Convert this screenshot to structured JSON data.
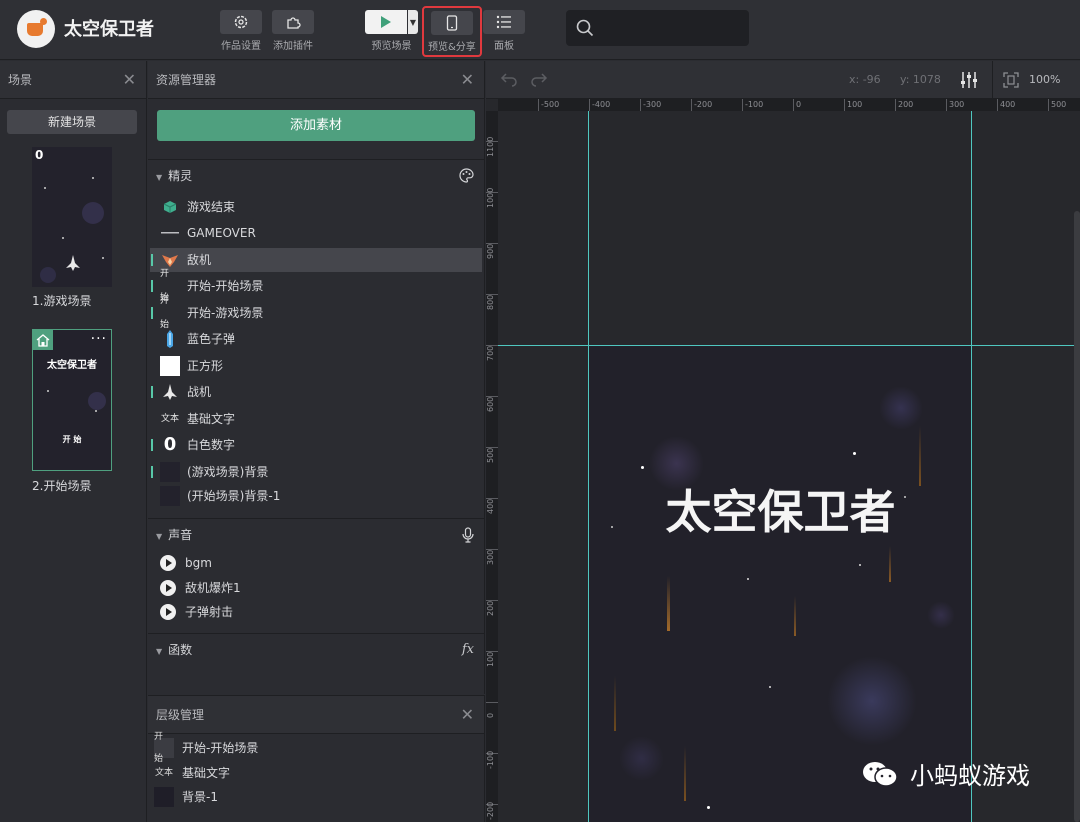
{
  "app": {
    "title": "太空保卫者"
  },
  "toolbar": {
    "settings_label": "作品设置",
    "plugin_label": "添加插件",
    "preview_scene_label": "预览场景",
    "preview_share_label": "预览&分享",
    "panel_label": "面板",
    "search_placeholder": ""
  },
  "scene_panel": {
    "title": "场景",
    "new_scene_label": "新建场景",
    "scenes": [
      {
        "label": "1.游戏场景",
        "score": "0"
      },
      {
        "label": "2.开始场景",
        "title": "太空保卫者",
        "button": "开 始"
      }
    ]
  },
  "asset_panel": {
    "title": "资源管理器",
    "add_asset_label": "添加素材",
    "sprites_header": "精灵",
    "sprites": [
      {
        "label": "游戏结束",
        "icon": "cube-icon"
      },
      {
        "label": "GAMEOVER",
        "icon": "text-line-icon"
      },
      {
        "label": "敌机",
        "icon": "enemy-plane-icon"
      },
      {
        "label": "开始-开始场景",
        "icon": "start-button-icon",
        "icon_text": "开 始"
      },
      {
        "label": "开始-游戏场景",
        "icon": "start-button-icon",
        "icon_text": "开 始"
      },
      {
        "label": "蓝色子弹",
        "icon": "bullet-icon"
      },
      {
        "label": "正方形",
        "icon": "square-icon"
      },
      {
        "label": "战机",
        "icon": "fighter-icon"
      },
      {
        "label": "基础文字",
        "icon": "text-icon",
        "icon_text": "文本"
      },
      {
        "label": "白色数字",
        "icon": "digit-icon",
        "icon_text": "0"
      },
      {
        "label": "(游戏场景)背景",
        "icon": "background-icon"
      },
      {
        "label": "(开始场景)背景-1",
        "icon": "background-icon"
      }
    ],
    "sounds_header": "声音",
    "sounds": [
      {
        "label": "bgm"
      },
      {
        "label": "敌机爆炸1"
      },
      {
        "label": "子弹射击"
      }
    ],
    "functions_header": "函数",
    "functions_icon_text": "fx"
  },
  "layer_panel": {
    "title": "层级管理",
    "layers": [
      {
        "label": "开始-开始场景",
        "icon_text": "开 始"
      },
      {
        "label": "基础文字",
        "icon_text": "文本"
      },
      {
        "label": "背景-1",
        "icon_text": ""
      }
    ]
  },
  "canvas": {
    "coord_x": "x: -96",
    "coord_y": "y: 1078",
    "zoom": "100%",
    "ruler_top": [
      "-500",
      "-400",
      "-300",
      "-200",
      "-100",
      "0",
      "100",
      "200",
      "300",
      "400",
      "500"
    ],
    "ruler_left": [
      "1100",
      "1000",
      "900",
      "800",
      "700",
      "600",
      "500",
      "400",
      "300",
      "200",
      "100",
      "0",
      "-100",
      "-200"
    ],
    "game_title": "太空保卫者"
  },
  "watermark": {
    "text": "小蚂蚁游戏"
  },
  "colors": {
    "accent": "#4fa07f",
    "guide": "#4fc7c0",
    "highlight": "#e0393e"
  }
}
